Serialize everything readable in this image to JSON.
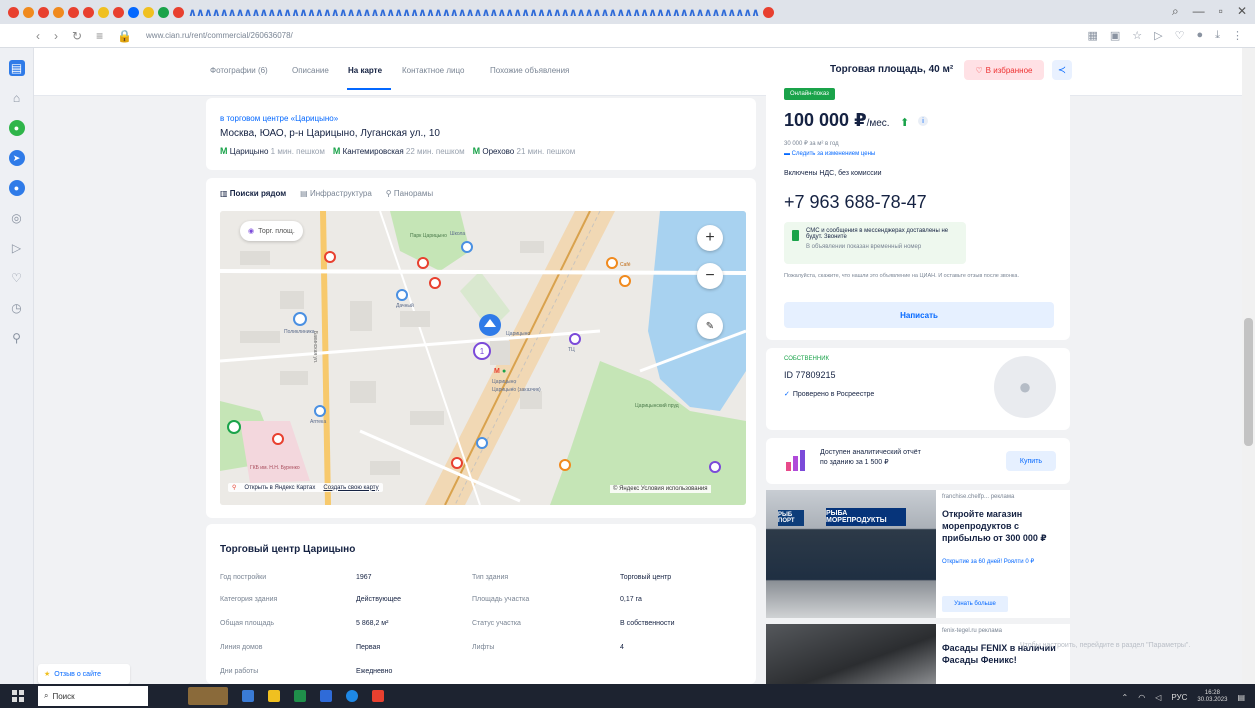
{
  "browser": {
    "url": "www.cian.ru/rent/commercial/260636078/"
  },
  "subnav": {
    "tabs": [
      "Фотографии (6)",
      "Описание",
      "На карте",
      "Контактное лицо",
      "Похожие объявления"
    ],
    "title": "Торговая площадь, 40 м²",
    "favorite_label": "В избранное"
  },
  "address_card": {
    "mall_link": "в торговом центре «Царицыно»",
    "address": "Москва, ЮАО, р-н Царицыно, Луганская ул., 10",
    "metro": [
      {
        "name": "Царицыно",
        "time": "1 мин. пешком"
      },
      {
        "name": "Кантемировская",
        "time": "22 мин. пешком"
      },
      {
        "name": "Орехово",
        "time": "21 мин. пешком"
      }
    ]
  },
  "map": {
    "tabs": [
      "Поиски рядом",
      "Инфраструктура",
      "Панорамы"
    ],
    "chip": "Торг. площ.",
    "open_yandex": "Открыть в Яндекс Картах",
    "create_route": "Создать свою карту",
    "copyright": "© Яндекс Условия использования",
    "cluster_count": "1",
    "labels": {
      "metro_station": "Царицыно",
      "metro_station2": "Царицыно (заказчик)",
      "pond": "Царицынский пруд",
      "street": "Бакинская ул.",
      "dachny": "Дачный",
      "tsaritsyno_station": "Царицыно",
      "cafe": "Café",
      "polyclinic": "Поликлиника",
      "school": "Школа",
      "shop": "ТЦ",
      "park": "Парк Царицыно",
      "hospital": "ГКБ им. Н.Н. Буренко",
      "pharmacy": "Аптека"
    }
  },
  "building": {
    "title": "Торговый центр Царицыно",
    "rows": [
      {
        "k": "Год постройки",
        "v": "1967",
        "k2": "Тип здания",
        "v2": "Торговый центр"
      },
      {
        "k": "Категория здания",
        "v": "Действующее",
        "k2": "Площадь участка",
        "v2": "0,17 га"
      },
      {
        "k": "Общая площадь",
        "v": "5 868,2 м²",
        "k2": "Статус участка",
        "v2": "В собственности"
      },
      {
        "k": "Линия домов",
        "v": "Первая",
        "k2": "Лифты",
        "v2": "4"
      },
      {
        "k": "Дни работы",
        "v": "Ежедневно",
        "k2": "",
        "v2": ""
      }
    ]
  },
  "price_card": {
    "online_badge": "Онлайн-показ",
    "price": "100 000 ₽",
    "price_unit": "/мес.",
    "per_m2": "30 000 ₽ за м² в год",
    "follow_price": "Следить за изменением цены",
    "vat": "Включены НДС, без комиссии",
    "phone": "+7 963 688-78-47",
    "sms_title": "СМС и сообщения в мессенджерах доставлены не будут. Звоните",
    "sms_sub": "В объявлении показан временный номер",
    "note": "Пожалуйста, скажите, что нашли это объявление на ЦИАН. И оставьте отзыв после звонка.",
    "write_button": "Написать"
  },
  "owner_card": {
    "label": "СОБСТВЕННИК",
    "id": "ID 77809215",
    "verified": "Проверено в Росреестре"
  },
  "report_card": {
    "text_line1": "Доступен аналитический отчёт",
    "text_line2": "по зданию за 1 500 ₽",
    "buy_button": "Купить"
  },
  "ad1": {
    "source": "franchise.chelfp... реклама",
    "title": "Откройте магазин морепродуктов с прибылью от 300 000 ₽",
    "subtitle": "Открытие за 60 дней! Роялти 0 ₽",
    "sign1": "РЫБ ПОРТ",
    "sign2": "РЫБА МОРЕПРОДУКТЫ",
    "button": "Узнать больше"
  },
  "ad2": {
    "source": "fenix-tegel.ru реклама",
    "title": "Фасады FENIX в наличии Фасады Феникс!"
  },
  "ghost_text": "Чтобы настроить, перейдите в раздел \"Параметры\".",
  "feedback": {
    "label": "Отзыв о сайте"
  },
  "taskbar": {
    "search": "Поиск",
    "tray_lang": "РУС",
    "time": "16:28",
    "date": "30.03.2023"
  },
  "colors": {
    "accent": "#0468ff",
    "green": "#1aa34a",
    "water": "#a8d2f0",
    "park": "#c5e5b6"
  }
}
